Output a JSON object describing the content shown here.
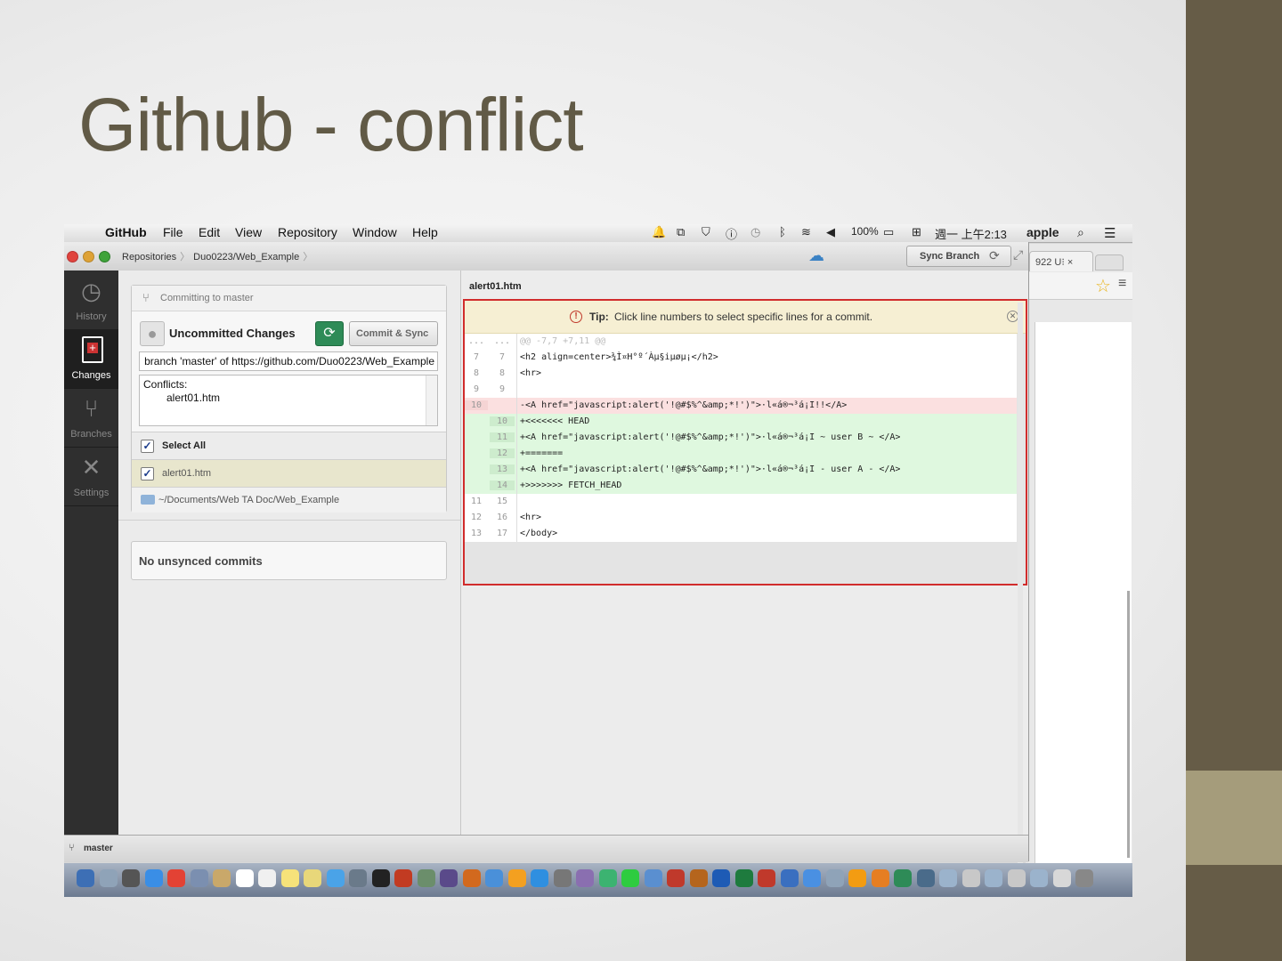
{
  "slide": {
    "title": "Github - conflict"
  },
  "menubar": {
    "app": "GitHub",
    "items": [
      "File",
      "Edit",
      "View",
      "Repository",
      "Window",
      "Help"
    ],
    "status": {
      "battery": "100%",
      "clock": "週一 上午2:13",
      "user": "apple"
    }
  },
  "browser": {
    "tab_label": "922 U⁝ ×"
  },
  "titlebar": {
    "breadcrumb": [
      "Repositories",
      "Duo0223/Web_Example"
    ],
    "sync_branch_label": "Sync Branch"
  },
  "nav": [
    {
      "label": "History",
      "icon": "history-icon"
    },
    {
      "label": "Changes",
      "icon": "changes-icon"
    },
    {
      "label": "Branches",
      "icon": "branch-icon"
    },
    {
      "label": "Settings",
      "icon": "settings-icon"
    }
  ],
  "commit": {
    "committing_label": "Committing to master",
    "title": "Uncommitted Changes",
    "commit_sync_label": "Commit & Sync",
    "summary_value": "branch 'master' of https://github.com/Duo0223/Web_Example",
    "description_line1": "Conflicts:",
    "description_line2": "alert01.htm",
    "select_all_label": "Select All",
    "file_name": "alert01.htm",
    "repo_path": "~/Documents/Web TA Doc/Web_Example"
  },
  "unsynced": {
    "label": "No unsynced commits"
  },
  "diff": {
    "filename": "alert01.htm",
    "tip_bold": "Tip:",
    "tip_text": "Click line numbers to select specific lines for a commit.",
    "lines": [
      {
        "type": "hunk",
        "old": "...",
        "new": "...",
        "text": "@@ -7,7 +7,11 @@"
      },
      {
        "type": "ctx",
        "old": "7",
        "new": "7",
        "text": "  <h2 align=center>¾Ì¤H°º´Àµ§iµøµ¡</h2>"
      },
      {
        "type": "ctx",
        "old": "8",
        "new": "8",
        "text": "  <hr>"
      },
      {
        "type": "ctx",
        "old": "9",
        "new": "9",
        "text": ""
      },
      {
        "type": "del",
        "old": "10",
        "new": "",
        "text": "-<A href=\"javascript:alert('!@#$%^&amp;*!')\">·l«á®¬³á¡I!!</A>"
      },
      {
        "type": "add",
        "old": "",
        "new": "10",
        "text": "+<<<<<<< HEAD"
      },
      {
        "type": "add",
        "old": "",
        "new": "11",
        "text": "+<A href=\"javascript:alert('!@#$%^&amp;*!')\">·l«á®¬³á¡I ~ user B ~ </A>"
      },
      {
        "type": "add",
        "old": "",
        "new": "12",
        "text": "+======="
      },
      {
        "type": "add",
        "old": "",
        "new": "13",
        "text": "+<A href=\"javascript:alert('!@#$%^&amp;*!')\">·l«á®¬³á¡I - user A - </A>"
      },
      {
        "type": "add",
        "old": "",
        "new": "14",
        "text": "+>>>>>>> FETCH_HEAD"
      },
      {
        "type": "ctx",
        "old": "11",
        "new": "15",
        "text": ""
      },
      {
        "type": "ctx",
        "old": "12",
        "new": "16",
        "text": "  <hr>"
      },
      {
        "type": "ctx",
        "old": "13",
        "new": "17",
        "text": "  </body>"
      }
    ]
  },
  "statusbar": {
    "branch": "master"
  },
  "colors": {
    "slide_title": "#615a46",
    "accent_bar": "#665c47",
    "accent_bar_light": "#a59c7b",
    "conflict_border": "#d12c2c",
    "added_bg": "#dff8df",
    "deleted_bg": "#fbe0e0",
    "tip_bg": "#f6efd3"
  },
  "dock_colors": [
    "#3d6fb5",
    "#8fa3b8",
    "#555",
    "#3a8ee6",
    "#e34234",
    "#7b8fb0",
    "#c9a86a",
    "#fff",
    "#f0f0f0",
    "#f6e27a",
    "#e8d77a",
    "#4aa3e8",
    "#6a7a8a",
    "#222",
    "#c23b22",
    "#6b8e6b",
    "#5a4a8a",
    "#d2691e",
    "#4a90d9",
    "#f4a020",
    "#2f8fe0",
    "#777",
    "#8a6fb0",
    "#3cb371",
    "#2ecc40",
    "#5a8fd0",
    "#c0392b",
    "#b5651d",
    "#1e5bb5",
    "#1e7b3e",
    "#c0392b",
    "#3a6fc0",
    "#4a90e2",
    "#8fa3b8",
    "#f39c12",
    "#e67e22",
    "#2e8b57",
    "#4a6b8a",
    "#9bb3cc",
    "#c8c8c8",
    "#9bb3cc",
    "#c8c8c8",
    "#9bb3cc",
    "#d8d8d8",
    "#888"
  ]
}
